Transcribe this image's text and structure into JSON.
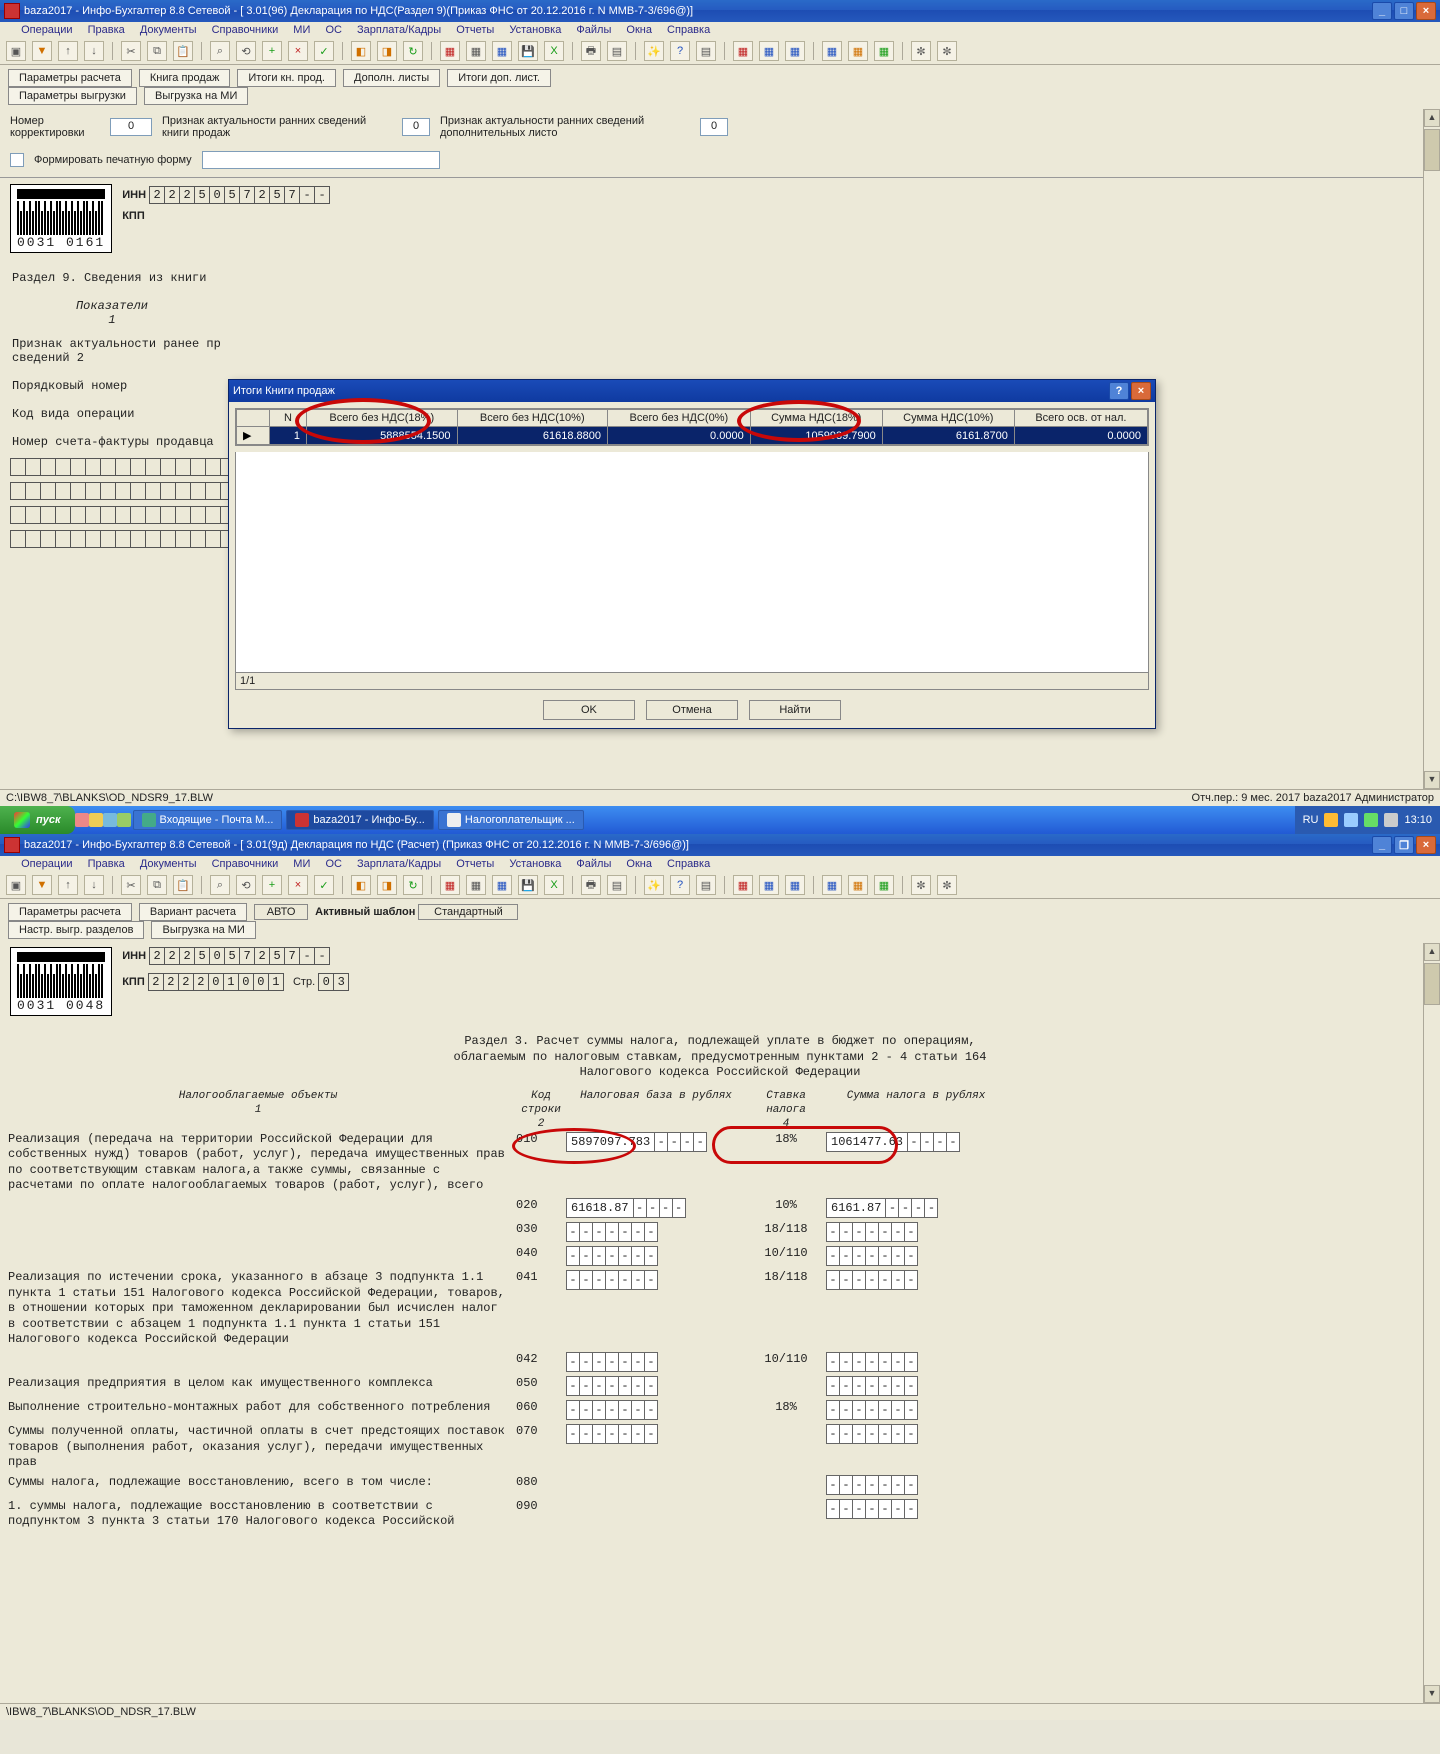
{
  "upper": {
    "title": "baza2017 - Инфо-Бухгалтер 8.8 Сетевой - [     3.01(96) Декларация по НДС(Раздел 9)(Приказ ФНС от 20.12.2016 г. N ММВ-7-3/696@)]",
    "menu": [
      "Операции",
      "Правка",
      "Документы",
      "Справочники",
      "МИ",
      "ОС",
      "Зарплата/Кадры",
      "Отчеты",
      "Установка",
      "Файлы",
      "Окна",
      "Справка"
    ],
    "tabs_row1": [
      "Параметры расчета",
      "Книга продаж",
      "Итоги кн. прод.",
      "Дополн. листы",
      "Итоги доп. лист."
    ],
    "tabs_row2": [
      "Параметры выгрузки",
      "Выгрузка на МИ"
    ],
    "f1_label": "Номер корректировки",
    "f1_val": "0",
    "f2_label": "Признак актуальности ранних сведений книги продаж",
    "f2_val": "0",
    "f3_label": "Признак актуальности ранних сведений дополнительных листо",
    "f3_val": "0",
    "chk_label": "Формировать печатную форму",
    "inn_label": "ИНН",
    "inn": [
      "2",
      "2",
      "2",
      "5",
      "0",
      "5",
      "7",
      "2",
      "5",
      "7",
      "-",
      "-"
    ],
    "kpp_label": "КПП",
    "section_title": "Раздел 9. Сведения из книги",
    "pok_label": "Показатели",
    "pok_sub": "1",
    "line_a": "Признак актуальности ранее пр",
    "line_b": "сведений 2",
    "line_c": "Порядковый номер",
    "line_d": "Код вида операции",
    "line_e": "Номер счета-фактуры продавца",
    "barcode": "0031 0161",
    "status_path": "C:\\IBW8_7\\BLANKS\\OD_NDSR9_17.BLW",
    "status_right": "Отч.пер.: 9 мес. 2017  baza2017  Администратор"
  },
  "modal": {
    "title": "Итоги Книги продаж",
    "cols": [
      "N",
      "Всего без НДС(18%)",
      "Всего без НДС(10%)",
      "Всего без НДС(0%)",
      "Сумма НДС(18%)",
      "Сумма НДС(10%)",
      "Всего осв. от нал."
    ],
    "row": [
      "1",
      "5888554.1500",
      "61618.8800",
      "0.0000",
      "1059939.7900",
      "6161.8700",
      "0.0000"
    ],
    "pager": "1/1",
    "btn_ok": "OK",
    "btn_cancel": "Отмена",
    "btn_find": "Найти"
  },
  "taskbar": {
    "start": "пуск",
    "items": [
      "Входящие - Почта M...",
      "baza2017 - Инфо-Бу...",
      "Налогоплательщик ..."
    ],
    "lang": "RU",
    "time": "13:10"
  },
  "lower": {
    "title": "baza2017 - Инфо-Бухгалтер 8.8 Сетевой - [     3.01(9д) Декларация по НДС (Расчет) (Приказ ФНС от 20.12.2016 г. N ММВ-7-3/696@)]",
    "menu": [
      "Операции",
      "Правка",
      "Документы",
      "Справочники",
      "МИ",
      "ОС",
      "Зарплата/Кадры",
      "Отчеты",
      "Установка",
      "Файлы",
      "Окна",
      "Справка"
    ],
    "tabs_row1": [
      "Параметры расчета",
      "Вариант расчета"
    ],
    "var_val": "АВТО",
    "tmpl_label": "Активный шаблон",
    "tmpl_val": "Стандартный",
    "tabs_row2": [
      "Настр. выгр. разделов",
      "Выгрузка на МИ"
    ],
    "inn_label": "ИНН",
    "inn": [
      "2",
      "2",
      "2",
      "5",
      "0",
      "5",
      "7",
      "2",
      "5",
      "7",
      "-",
      "-"
    ],
    "kpp_label": "КПП",
    "kpp": [
      "2",
      "2",
      "2",
      "2",
      "0",
      "1",
      "0",
      "0",
      "1"
    ],
    "page_label": "Стр.",
    "page_a": "0",
    "page_b": "3",
    "barcode": "0031 0048",
    "hdr1": "Раздел 3.  Расчет суммы налога, подлежащей уплате в бюджет по операциям,",
    "hdr2": "облагаемым по налоговым ставкам, предусмотренным пунктами 2 - 4 статьи 164",
    "hdr3": "Налогового кодекса Российской Федерации",
    "col1": "Налогооблагаемые объекты",
    "col1s": "1",
    "col2": "Код строки",
    "col2s": "2",
    "col3": "Налоговая база в рублях",
    "col4": "Ставка налога",
    "col4s": "4",
    "col5": "Сумма налога в рублях",
    "rows": [
      {
        "txt": " Реализация (передача на территории Российской Федерации для собственных нужд) товаров (работ, услуг), передача имущественных прав по соответствующим ставкам налога,а также суммы, связанные с расчетами по оплате налогооблагаемых товаров (работ, услуг), всего",
        "code": "010",
        "base": "5897097.783",
        "rate": "18%",
        "tax": "1061477.63"
      },
      {
        "txt": "",
        "code": "020",
        "base": "61618.87",
        "rate": "10%",
        "tax": "6161.87"
      },
      {
        "txt": "",
        "code": "030",
        "base": "",
        "rate": "18/118",
        "tax": ""
      },
      {
        "txt": "",
        "code": "040",
        "base": "",
        "rate": "10/110",
        "tax": ""
      },
      {
        "txt": " Реализация по истечении срока, указанного в абзаце 3 подпункта 1.1 пункта 1 статьи 151 Налогового кодекса Российской Федерации, товаров, в отношении которых при таможенном декларировании был исчислен налог в соответствии с абзацем 1 подпункта 1.1 пункта 1 статьи 151 Налогового кодекса Российской Федерации",
        "code": "041",
        "base": "",
        "rate": "18/118",
        "tax": ""
      },
      {
        "txt": "",
        "code": "042",
        "base": "",
        "rate": "10/110",
        "tax": ""
      },
      {
        "txt": " Реализация предприятия в целом как имущественного комплекса",
        "code": "050",
        "base": "",
        "rate": "",
        "tax": ""
      },
      {
        "txt": " Выполнение строительно-монтажных работ для собственного потребления",
        "code": "060",
        "base": "",
        "rate": "18%",
        "tax": ""
      },
      {
        "txt": " Суммы полученной оплаты, частичной оплаты в счет предстоящих поставок товаров (выполнения работ, оказания услуг), передачи имущественных прав",
        "code": "070",
        "base": "",
        "rate": "",
        "tax": ""
      },
      {
        "txt": " Суммы налога, подлежащие восстановлению, всего в том числе:",
        "code": "080",
        "base": "none",
        "rate": "",
        "tax": ""
      },
      {
        "txt": "1. суммы налога, подлежащие восстановлению в соответствии с подпунктом 3 пункта 3 статьи 170 Налогового кодекса Российской",
        "code": "090",
        "base": "none",
        "rate": "",
        "tax": ""
      }
    ],
    "status_path": "\\IBW8_7\\BLANKS\\OD_NDSR_17.BLW"
  }
}
